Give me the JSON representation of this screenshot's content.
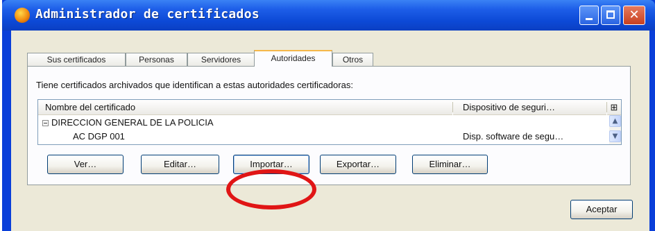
{
  "window": {
    "title": "Administrador de certificados",
    "icon": "firefox-icon",
    "controls": [
      "minimize-icon",
      "maximize-icon",
      "close-icon"
    ]
  },
  "tabs": [
    {
      "label": "Sus certificados",
      "active": false
    },
    {
      "label": "Personas",
      "active": false
    },
    {
      "label": "Servidores",
      "active": false
    },
    {
      "label": "Autoridades",
      "active": true
    },
    {
      "label": "Otros",
      "active": false
    }
  ],
  "panel": {
    "description": "Tiene certificados archivados que identifican a estas autoridades certificadoras:",
    "columns": [
      "Nombre del certificado",
      "Dispositivo de seguri…",
      "column-picker-icon"
    ],
    "rows": [
      {
        "name": "DIRECCION GENERAL DE LA POLICIA",
        "device": "",
        "expanded": true
      },
      {
        "name": "AC DGP 001",
        "device": "Disp. software de segu…"
      }
    ]
  },
  "buttons": {
    "view": "Ver…",
    "edit": "Editar…",
    "import": "Importar…",
    "export": "Exportar…",
    "delete": "Eliminar…",
    "ok": "Aceptar"
  },
  "colors": {
    "titlebar": "#0c49d6",
    "client": "#ece9d8",
    "active_tab_accent": "#f5b84a",
    "highlight_ring": "#e01515"
  }
}
